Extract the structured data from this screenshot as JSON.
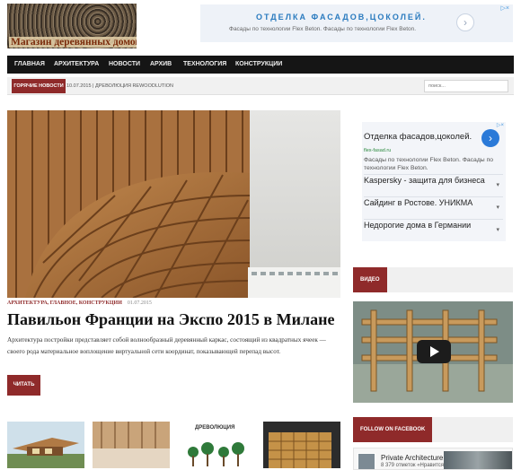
{
  "header": {
    "logo_text": "Магазин деревянных домов"
  },
  "top_ad": {
    "title": "ОТДЕЛКА ФАСАДОВ,ЦОКОЛЕЙ.",
    "subtitle": "Фасады по технологии Flex Beton. Фасады по технологии Flex Beton.",
    "arrow": "›",
    "adchoices": "▷×"
  },
  "nav": {
    "items": [
      "ГЛАВНАЯ",
      "АРХИТЕКТУРА",
      "НОВОСТИ",
      "АРХИВ",
      "ТЕХНОЛОГИЯ",
      "КОНСТРУКЦИИ"
    ]
  },
  "ticker": {
    "label": "ГОРЯЧИЕ НОВОСТИ",
    "text": "10.07.2015 | ДРЕВОЛЮЦИЯ REWOODLUTION"
  },
  "search": {
    "placeholder": "поиск..."
  },
  "article": {
    "categories": "АРХИТЕКТУРА, ГЛАВНОЕ, КОНСТРУКЦИИ",
    "date": "01.07.2015",
    "title": "Павильон Франции на Экспо 2015 в Милане",
    "excerpt": "Архитектура постройки представляет собой волнообразный деревянный каркас, состоящий из квадратных ячеек — своего рода материальное воплощение виртуальной сети координат, показывающей перепад высот.",
    "read_more": "ЧИТАТЬ"
  },
  "thumbs": {
    "third_caption": "ДРЕВОЛЮЦИЯ"
  },
  "sidebar": {
    "ad": {
      "title": "Отделка фасадов,цоколей.",
      "url": "flex-fasad.ru",
      "description": "Фасады по технологии Flex Beton. Фасады по технологии Flex Beton.",
      "arrow": "›",
      "adchoices": "▷×",
      "links": [
        "Kaspersky - защита для бизнеса",
        "Сайдинг в Ростове. УНИКМА",
        "Недорогие дома в Германии"
      ],
      "chevron": "▾"
    },
    "video_label": "ВИДЕО",
    "facebook_label": "FOLLOW ON FACEBOOK",
    "facebook": {
      "page_name": "Private Architecture",
      "likes": "8 379 отметок «Нравится»"
    }
  },
  "colors": {
    "accent": "#8f2a2a",
    "nav_bg": "#151515",
    "ad_blue": "#2a7bbf"
  }
}
